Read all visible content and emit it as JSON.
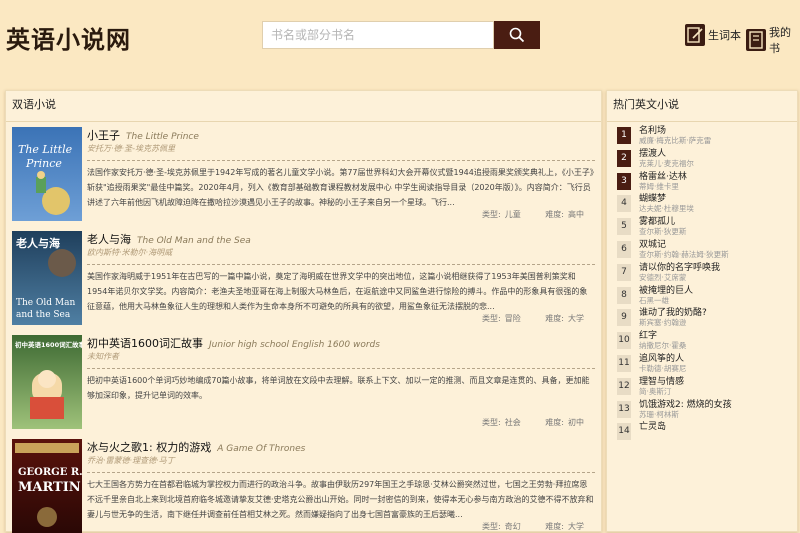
{
  "site": {
    "title": "英语小说网"
  },
  "search": {
    "placeholder": "书名或部分书名"
  },
  "nav": {
    "vocab": "生词本",
    "my_books": "我的书"
  },
  "main": {
    "section_title": "双语小说",
    "type_label": "类型:",
    "difficulty_label": "难度:",
    "books": [
      {
        "title": "小王子",
        "title_en": "The Little Prince",
        "author": "安托万·德·圣-埃克苏佩里",
        "desc": "法国作家安托万·德·圣-埃克苏佩里于1942年写成的著名儿童文学小说。第77届世界科幻大会开幕仪式暨1944追授雨果奖颁奖典礼上，《小王子》斩获\"追授雨果奖\"最佳中篇奖。2020年4月，列入《教育部基础教育课程教材发展中心 中学生阅读指导目录（2020年版）》。内容简介：飞行员讲述了六年前他因飞机故障迫降在撒哈拉沙漠遇见小王子的故事。神秘的小王子来自另一个星球。飞行...",
        "type": "儿童",
        "difficulty": "高中",
        "cover_text": "The Little Prince",
        "cover_color": "#3a6fb0"
      },
      {
        "title": "老人与海",
        "title_en": "The Old Man and the Sea",
        "author": "欧内斯特·米勒尔·海明威",
        "desc": "美国作家海明威于1951年在古巴写的一篇中篇小说，奠定了海明威在世界文学中的突出地位，这篇小说相继获得了1953年美国普利策奖和1954年诺贝尔文学奖。内容简介：老渔夫圣地亚哥在海上制服大马林鱼后，在返航途中又同鲨鱼进行惊险的搏斗。作品中的形象具有很强的象征意蕴，他用大马林鱼象征人生的理想和人类作为生命本身所不可避免的所具有的欲望，用鲨鱼象征无法摆脱的悲...",
        "type": "冒险",
        "difficulty": "大学",
        "cover_text": "老人与海 The Old Man and the Sea",
        "cover_color": "#2d5270"
      },
      {
        "title": "初中英语1600词汇故事",
        "title_en": "Junior high school English 1600 words",
        "author": "未知作者",
        "desc": "把初中英语1600个单词巧妙地编成70篇小故事，将单词放在文段中去理解。联系上下文、加以一定的推测、而且文章是连贯的、具备，更加能够加深印象，提升记单词的效率。",
        "type": "社会",
        "difficulty": "初中",
        "cover_text": "初中英语1600词汇故事",
        "cover_color": "#4f7a3f"
      },
      {
        "title": "冰与火之歌1: 权力的游戏",
        "title_en": "A Game Of Thrones",
        "author": "乔治·雷蒙德·理查德·马丁",
        "desc": "七大王国各方势力在首都君临城为掌控权力而进行的政治斗争。故事由伊耿历297年国王之手琼恩·艾林公爵突然过世，七国之王劳勃·拜拉席恩不远千里亲自北上来到北境首府临冬城邀请挚友艾德·史塔克公爵出山开始。同时一封密信的到来，使得本无心参与南方政治的艾德不得不放弃和妻儿与世无争的生活，南下继任并调查前任首相艾林之死。然而嫌疑指向了出身七国首富豪族的王后瑟曦...",
        "type": "奇幻",
        "difficulty": "大学",
        "cover_text": "GEORGE R.R. MARTIN",
        "cover_color": "#7a1a12"
      }
    ]
  },
  "sidebar": {
    "title": "热门英文小说",
    "items": [
      {
        "rank": "1",
        "name": "名利场",
        "author": "威廉·梅克比斯·萨克雷"
      },
      {
        "rank": "2",
        "name": "摆渡人",
        "author": "克莱儿·麦克福尔"
      },
      {
        "rank": "3",
        "name": "格雷丝·达林",
        "author": "蒂姆·维卡里"
      },
      {
        "rank": "4",
        "name": "蝴蝶梦",
        "author": "达夫妮·杜穆里埃"
      },
      {
        "rank": "5",
        "name": "雾都孤儿",
        "author": "查尔斯·狄更斯"
      },
      {
        "rank": "6",
        "name": "双城记",
        "author": "查尔斯·约翰·赫法姆·狄更斯"
      },
      {
        "rank": "7",
        "name": "请以你的名字呼唤我",
        "author": "安德烈·艾席蒙"
      },
      {
        "rank": "8",
        "name": "被掩埋的巨人",
        "author": "石黑一雄"
      },
      {
        "rank": "9",
        "name": "谁动了我的奶酪?",
        "author": "斯宾塞·约翰逊"
      },
      {
        "rank": "10",
        "name": "红字",
        "author": "纳撒尼尔·霍桑"
      },
      {
        "rank": "11",
        "name": "追风筝的人",
        "author": "卡勒德·胡赛尼"
      },
      {
        "rank": "12",
        "name": "理智与情感",
        "author": "简·奥斯汀"
      },
      {
        "rank": "13",
        "name": "饥饿游戏2: 燃烧的女孩",
        "author": "苏珊·柯林斯"
      },
      {
        "rank": "14",
        "name": "亡灵岛",
        "author": ""
      }
    ]
  },
  "colors": {
    "background": "#fbe8c2",
    "accent": "#4a1d12",
    "panel": "#fdf1d9"
  }
}
